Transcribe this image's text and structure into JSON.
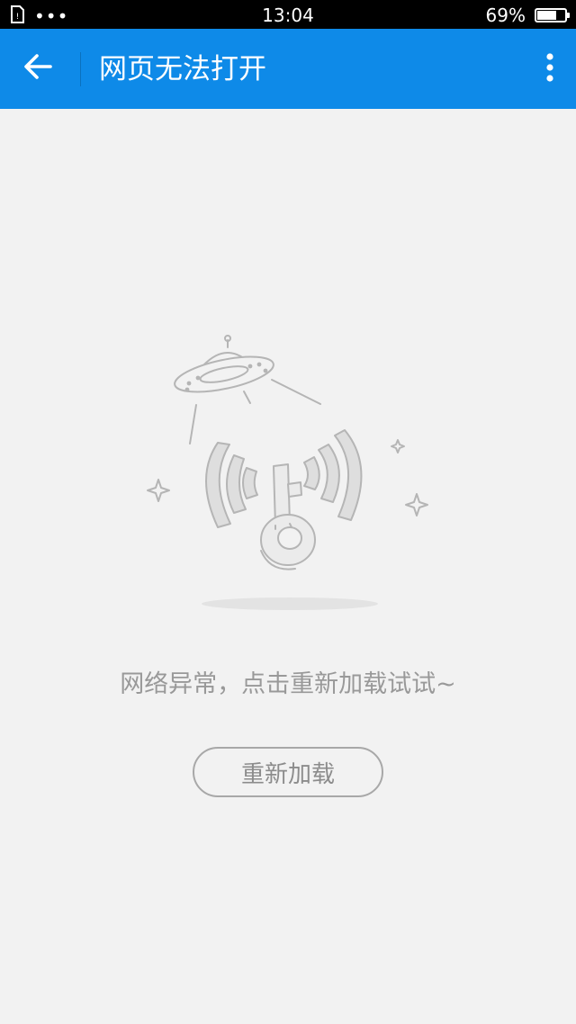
{
  "status_bar": {
    "time": "13:04",
    "battery_percent_text": "69%",
    "battery_level": 0.69,
    "overflow_dots": "•••",
    "left_icon": "sim-card-icon"
  },
  "app_bar": {
    "title": "网页无法打开",
    "back_icon": "arrow-left-icon",
    "more_icon": "more-vertical-icon",
    "background_color": "#0e8ae8"
  },
  "content": {
    "illustration": "no-network-ufo-wifi-key-illustration",
    "message": "网络异常，点击重新加载试试~",
    "reload_button_label": "重新加载"
  },
  "colors": {
    "accent": "#0e8ae8",
    "page_background": "#f2f2f2",
    "message_text": "#999999",
    "illustration_stroke": "#b5b5b5"
  }
}
